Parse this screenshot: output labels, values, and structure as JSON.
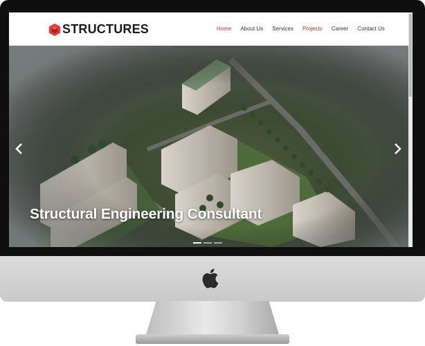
{
  "site": {
    "logo_text": "STRUCTURES",
    "brand_color": "#e53935"
  },
  "nav": {
    "items": [
      {
        "label": "Home",
        "state": "active"
      },
      {
        "label": "About Us",
        "state": "normal"
      },
      {
        "label": "Services",
        "state": "normal"
      },
      {
        "label": "Projects",
        "state": "highlight"
      },
      {
        "label": "Career",
        "state": "normal"
      },
      {
        "label": "Contact Us",
        "state": "normal"
      }
    ],
    "active_color": "#d32f2f",
    "text_color": "#333333"
  },
  "hero": {
    "title": "Structural Engineering Consultant",
    "prev_icon": "chevron-left-icon",
    "next_icon": "chevron-right-icon",
    "slides_count": 3,
    "active_slide": 1
  },
  "device": {
    "logo_icon": "apple-icon"
  }
}
